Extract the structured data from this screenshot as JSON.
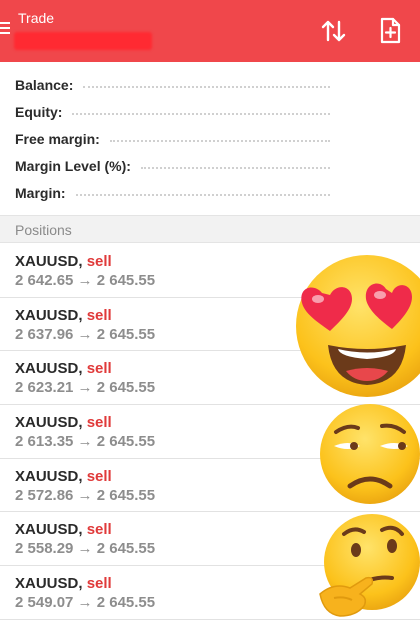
{
  "header": {
    "title": "Trade",
    "account_name": "",
    "colors": {
      "bar": "#f0474b",
      "sell": "#e03a3a"
    },
    "icons": [
      "menu-icon",
      "sort-icon",
      "new-order-icon"
    ]
  },
  "summary": {
    "balance_label": "Balance:",
    "equity_label": "Equity:",
    "free_margin_label": "Free margin:",
    "margin_level_label": "Margin Level (%):",
    "margin_label": "Margin:"
  },
  "positions": {
    "title": "Positions",
    "items": [
      {
        "symbol": "XAUUSD,",
        "side": "sell",
        "prices": "2 642.65 → 2 645.55"
      },
      {
        "symbol": "XAUUSD,",
        "side": "sell",
        "prices": "2 637.96 → 2 645.55"
      },
      {
        "symbol": "XAUUSD,",
        "side": "sell",
        "prices": "2 623.21 → 2 645.55"
      },
      {
        "symbol": "XAUUSD,",
        "side": "sell",
        "prices": "2 613.35 → 2 645.55"
      },
      {
        "symbol": "XAUUSD,",
        "side": "sell",
        "prices": "2 572.86 → 2 645.55"
      },
      {
        "symbol": "XAUUSD,",
        "side": "sell",
        "prices": "2 558.29 → 2 645.55"
      },
      {
        "symbol": "XAUUSD,",
        "side": "sell",
        "prices": "2 549.07 → 2 645.55"
      }
    ]
  },
  "stickers": [
    "heart-eyes-emoji",
    "unamused-emoji",
    "thinking-emoji"
  ]
}
